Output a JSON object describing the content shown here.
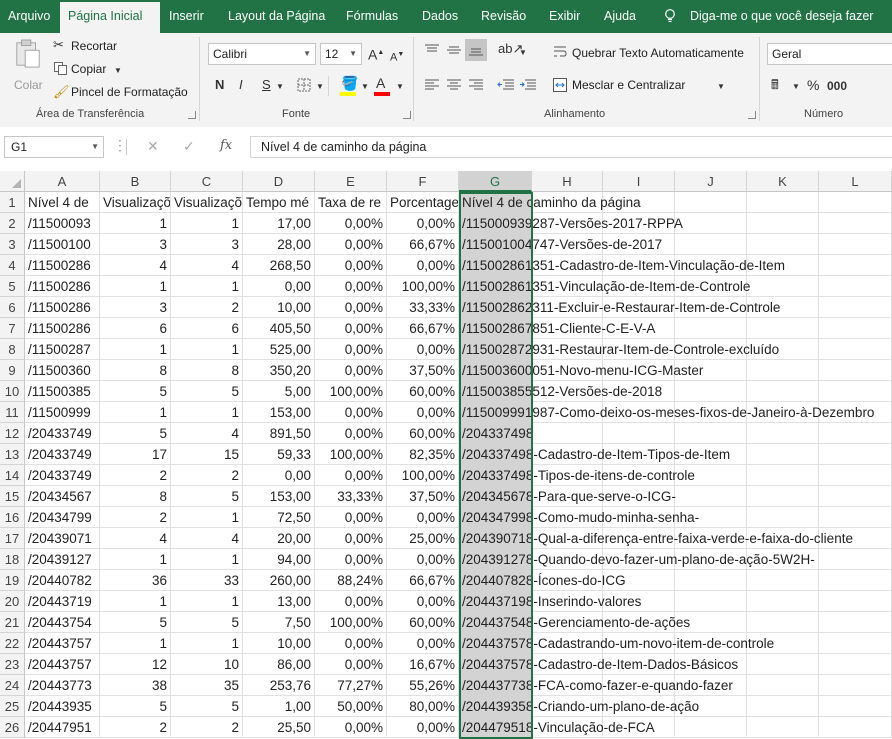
{
  "ribbon_tabs": [
    "Arquivo",
    "Página Inicial",
    "Inserir",
    "Layout da Página",
    "Fórmulas",
    "Dados",
    "Revisão",
    "Exibir",
    "Ajuda"
  ],
  "tell_me": "Diga-me o que você deseja fazer",
  "clipboard": {
    "paste": "Colar",
    "cut": "Recortar",
    "copy": "Copiar",
    "format_painter": "Pincel de Formatação",
    "group": "Área de Transferência"
  },
  "font": {
    "name": "Calibri",
    "size": "12",
    "bold": "N",
    "italic": "I",
    "underline": "S",
    "color_letter": "A",
    "group": "Fonte",
    "highlight_color": "#ffff00",
    "font_color": "#ff0000"
  },
  "alignment": {
    "wrap": "Quebrar Texto Automaticamente",
    "merge": "Mesclar e Centralizar",
    "group": "Alinhamento"
  },
  "number": {
    "format": "Geral",
    "percent": "%",
    "thousands": "000",
    "group": "Número"
  },
  "formula_bar": {
    "name_box": "G1",
    "fx": "fx",
    "formula": "Nível 4 de caminho da página"
  },
  "columns": [
    "A",
    "B",
    "C",
    "D",
    "E",
    "F",
    "G",
    "H",
    "I",
    "J",
    "K",
    "L"
  ],
  "selected_column": "G",
  "header_row": [
    "Nível 4 de",
    "Visualizaçõ",
    "Visualizaçõ",
    "Tempo mé",
    "Taxa de re",
    "Porcentage",
    "Nível 4 de caminho da página"
  ],
  "rows": [
    [
      "/11500093",
      "1",
      "1",
      "17,00",
      "0,00%",
      "0,00%",
      "/115000939287-Versões-2017-RPPA"
    ],
    [
      "/11500100",
      "3",
      "3",
      "28,00",
      "0,00%",
      "66,67%",
      "/115001004747-Versões-de-2017"
    ],
    [
      "/11500286",
      "4",
      "4",
      "268,50",
      "0,00%",
      "0,00%",
      "/115002861351-Cadastro-de-Item-Vinculação-de-Item"
    ],
    [
      "/11500286",
      "1",
      "1",
      "0,00",
      "0,00%",
      "100,00%",
      "/115002861351-Vinculação-de-Item-de-Controle"
    ],
    [
      "/11500286",
      "3",
      "2",
      "10,00",
      "0,00%",
      "33,33%",
      "/115002862311-Excluir-e-Restaurar-Item-de-Controle"
    ],
    [
      "/11500286",
      "6",
      "6",
      "405,50",
      "0,00%",
      "66,67%",
      "/115002867851-Cliente-C-E-V-A"
    ],
    [
      "/11500287",
      "1",
      "1",
      "525,00",
      "0,00%",
      "0,00%",
      "/115002872931-Restaurar-Item-de-Controle-excluído"
    ],
    [
      "/11500360",
      "8",
      "8",
      "350,20",
      "0,00%",
      "37,50%",
      "/115003600051-Novo-menu-ICG-Master"
    ],
    [
      "/11500385",
      "5",
      "5",
      "5,00",
      "100,00%",
      "60,00%",
      "/115003855512-Versões-de-2018"
    ],
    [
      "/11500999",
      "1",
      "1",
      "153,00",
      "0,00%",
      "0,00%",
      "/115009991987-Como-deixo-os-meses-fixos-de-Janeiro-à-Dezembro"
    ],
    [
      "/20433749",
      "5",
      "4",
      "891,50",
      "0,00%",
      "60,00%",
      "/204337498"
    ],
    [
      "/20433749",
      "17",
      "15",
      "59,33",
      "100,00%",
      "82,35%",
      "/204337498-Cadastro-de-Item-Tipos-de-Item"
    ],
    [
      "/20433749",
      "2",
      "2",
      "0,00",
      "0,00%",
      "100,00%",
      "/204337498-Tipos-de-itens-de-controle"
    ],
    [
      "/20434567",
      "8",
      "5",
      "153,00",
      "33,33%",
      "37,50%",
      "/204345678-Para-que-serve-o-ICG-"
    ],
    [
      "/20434799",
      "2",
      "1",
      "72,50",
      "0,00%",
      "0,00%",
      "/204347998-Como-mudo-minha-senha-"
    ],
    [
      "/20439071",
      "4",
      "4",
      "20,00",
      "0,00%",
      "25,00%",
      "/204390718-Qual-a-diferença-entre-faixa-verde-e-faixa-do-cliente"
    ],
    [
      "/20439127",
      "1",
      "1",
      "94,00",
      "0,00%",
      "0,00%",
      "/204391278-Quando-devo-fazer-um-plano-de-ação-5W2H-"
    ],
    [
      "/20440782",
      "36",
      "33",
      "260,00",
      "88,24%",
      "66,67%",
      "/204407828-Ícones-do-ICG"
    ],
    [
      "/20443719",
      "1",
      "1",
      "13,00",
      "0,00%",
      "0,00%",
      "/204437198-Inserindo-valores"
    ],
    [
      "/20443754",
      "5",
      "5",
      "7,50",
      "100,00%",
      "60,00%",
      "/204437548-Gerenciamento-de-ações"
    ],
    [
      "/20443757",
      "1",
      "1",
      "10,00",
      "0,00%",
      "0,00%",
      "/204437578-Cadastrando-um-novo-item-de-controle"
    ],
    [
      "/20443757",
      "12",
      "10",
      "86,00",
      "0,00%",
      "16,67%",
      "/204437578-Cadastro-de-Item-Dados-Básicos"
    ],
    [
      "/20443773",
      "38",
      "35",
      "253,76",
      "77,27%",
      "55,26%",
      "/204437738-FCA-como-fazer-e-quando-fazer"
    ],
    [
      "/20443935",
      "5",
      "5",
      "1,00",
      "50,00%",
      "80,00%",
      "/204439358-Criando-um-plano-de-ação"
    ],
    [
      "/20447951",
      "2",
      "2",
      "25,50",
      "0,00%",
      "0,00%",
      "/204479518-Vinculação-de-FCA"
    ]
  ]
}
